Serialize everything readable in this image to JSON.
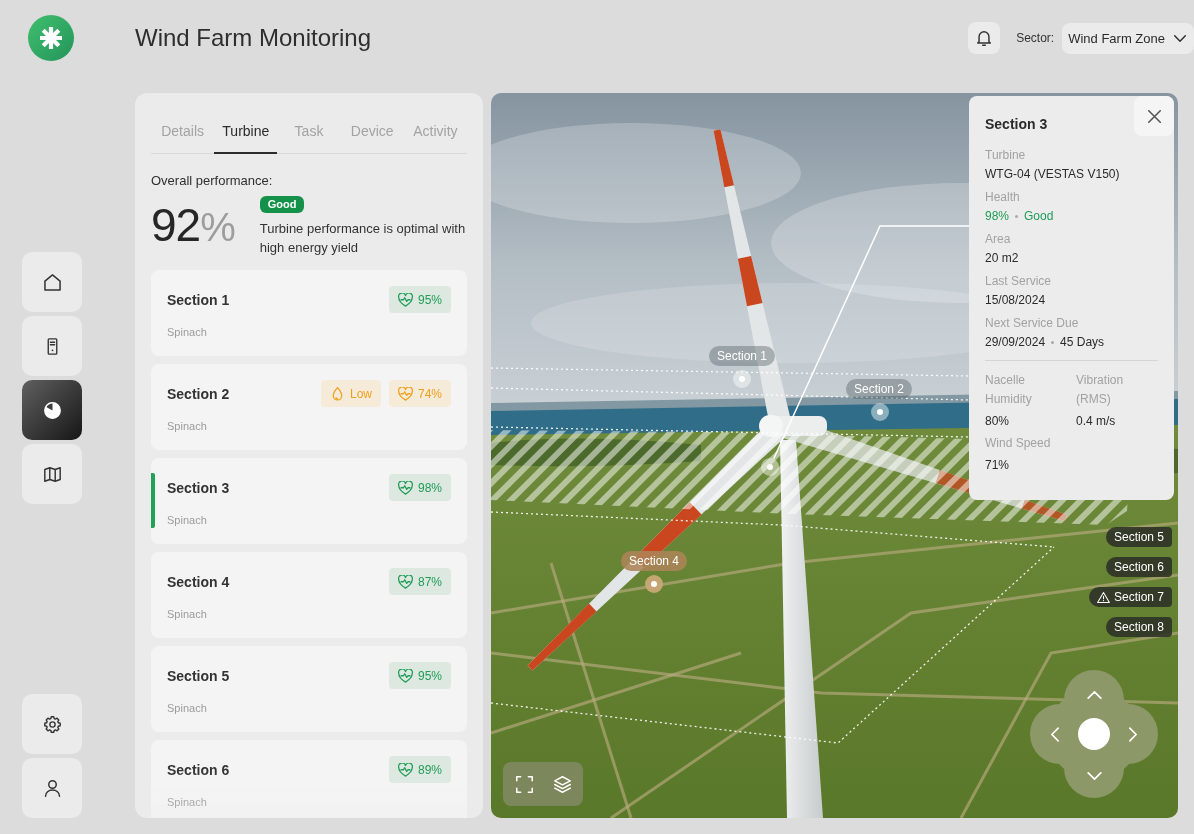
{
  "app": {
    "title": "Wind Farm Monitoring"
  },
  "nav": {
    "main": [
      {
        "selected": false
      },
      {
        "selected": false
      },
      {
        "selected": true
      },
      {
        "selected": false
      }
    ],
    "bottom": [
      {
        "selected": false
      },
      {
        "selected": false
      }
    ]
  },
  "header": {
    "sector_label": "Sector:",
    "sector_value": "Wind Farm Zone"
  },
  "panel": {
    "tabs": [
      {
        "label": "Details",
        "selected": false
      },
      {
        "label": "Turbine",
        "selected": true
      },
      {
        "label": "Task",
        "selected": false
      },
      {
        "label": "Device",
        "selected": false
      },
      {
        "label": "Activity",
        "selected": false
      }
    ],
    "performance": {
      "label": "Overall performance:",
      "value": "92",
      "unit": "%",
      "badge": "Good",
      "description": "Turbine performance is optimal with high energy yield"
    },
    "sections": [
      {
        "title": "Section 1",
        "subtitle": "Spinach",
        "selected": false,
        "badges": [
          {
            "kind": "health",
            "text": "95%",
            "warning": false
          }
        ]
      },
      {
        "title": "Section 2",
        "subtitle": "Spinach",
        "selected": false,
        "badges": [
          {
            "kind": "moisture",
            "text": "Low",
            "warning": true
          },
          {
            "kind": "health",
            "text": "74%",
            "warning": true
          }
        ]
      },
      {
        "title": "Section 3",
        "subtitle": "Spinach",
        "selected": true,
        "badges": [
          {
            "kind": "health",
            "text": "98%",
            "warning": false
          }
        ]
      },
      {
        "title": "Section 4",
        "subtitle": "Spinach",
        "selected": false,
        "badges": [
          {
            "kind": "health",
            "text": "87%",
            "warning": false
          }
        ]
      },
      {
        "title": "Section 5",
        "subtitle": "Spinach",
        "selected": false,
        "badges": [
          {
            "kind": "health",
            "text": "95%",
            "warning": false
          }
        ]
      },
      {
        "title": "Section 6",
        "subtitle": "Spinach",
        "selected": false,
        "badges": [
          {
            "kind": "health",
            "text": "89%",
            "warning": false
          }
        ]
      }
    ]
  },
  "map": {
    "markers": [
      {
        "label": "Section 1",
        "kind": "faded"
      },
      {
        "label": "Section 2",
        "kind": "faded"
      },
      {
        "label": "Section 4",
        "kind": "highlighted"
      }
    ],
    "edge_labels": [
      {
        "label": "Section 5",
        "warning": false
      },
      {
        "label": "Section 6",
        "warning": false
      },
      {
        "label": "Section 7",
        "warning": true
      },
      {
        "label": "Section 8",
        "warning": false
      }
    ],
    "detail": {
      "title": "Section 3",
      "fields": [
        {
          "label": "Turbine",
          "value": "WTG-04 (VESTAS V150)",
          "good": false
        },
        {
          "label": "Health",
          "value": "98%",
          "note": "Good",
          "good": true
        },
        {
          "label": "Area",
          "value": "20 m2",
          "good": false
        },
        {
          "label": "Last Service",
          "value": "15/08/2024",
          "good": false
        },
        {
          "label": "Next Service Due",
          "value": "29/09/2024",
          "note": "45 Days",
          "good": false
        }
      ],
      "metrics": [
        {
          "label": "Nacelle Humidity",
          "value": "80%"
        },
        {
          "label": "Vibration (RMS)",
          "value": "0.4 m/s"
        },
        {
          "label": "Wind Speed",
          "value": "71%"
        }
      ]
    }
  }
}
